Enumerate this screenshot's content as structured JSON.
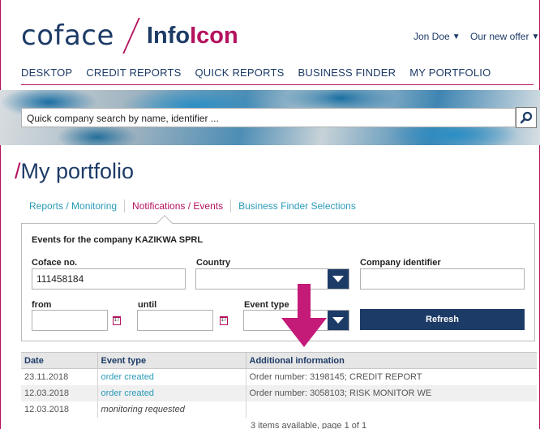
{
  "header": {
    "logo_brand": "coface",
    "logo_product_a": "Info",
    "logo_product_b": "Icon",
    "user": "Jon Doe",
    "offer": "Our new offer"
  },
  "nav": {
    "items": [
      "DESKTOP",
      "CREDIT REPORTS",
      "QUICK REPORTS",
      "BUSINESS FINDER",
      "MY PORTFOLIO"
    ]
  },
  "search": {
    "placeholder": "Quick company search by name, identifier ..."
  },
  "page": {
    "title_slash": "/",
    "title": "My portfolio"
  },
  "subtabs": [
    {
      "label": "Reports / Monitoring",
      "active": false
    },
    {
      "label": "Notifications / Events",
      "active": true
    },
    {
      "label": "Business Finder Selections",
      "active": false
    }
  ],
  "form": {
    "title": "Events for the company KAZIKWA SPRL",
    "coface_no_label": "Coface no.",
    "coface_no_value": "111458184",
    "country_label": "Country",
    "company_identifier_label": "Company identifier",
    "from_label": "from",
    "until_label": "until",
    "event_type_label": "Event type",
    "refresh_label": "Refresh",
    "calendar_icon_text": "17"
  },
  "table": {
    "headers": [
      "Date",
      "Event type",
      "Additional information"
    ],
    "rows": [
      {
        "date": "23.11.2018",
        "event": "order created",
        "info": "Order number: 3198145; CREDIT REPORT"
      },
      {
        "date": "12.03.2018",
        "event": "order created",
        "info": "Order number: 3058103; RISK MONITOR WE"
      },
      {
        "date": "12.03.2018",
        "event": "monitoring requested",
        "info": ""
      }
    ],
    "pager": "3 items available, page 1 of 1"
  },
  "colors": {
    "brand_navy": "#1d3b67",
    "accent_magenta": "#b4125e",
    "link_teal": "#2a9bb7"
  }
}
